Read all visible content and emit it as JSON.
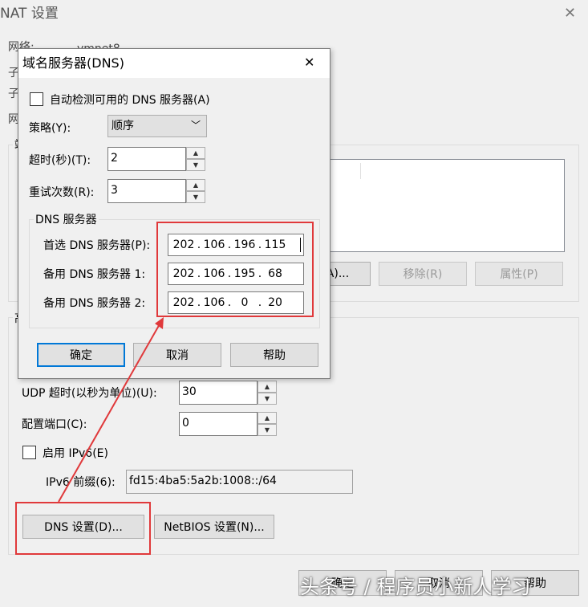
{
  "nat_window": {
    "title": "NAT 设置",
    "network_label": "网络:",
    "network_value": "vmnet8",
    "subnet_ip_label": "子",
    "subnet_mask_label": "子",
    "gateway_label": "网",
    "port_forward_label": "端",
    "buttons": {
      "add": "A)...",
      "remove": "移除(R)",
      "properties": "属性(P)"
    },
    "advanced_label": "高",
    "udp_timeout_label": "UDP 超时(以秒为单位)(U):",
    "udp_timeout_value": "30",
    "config_port_label": "配置端口(C):",
    "config_port_value": "0",
    "enable_ipv6_label": "启用 IPv6(E)",
    "ipv6_prefix_label": "IPv6 前缀(6):",
    "ipv6_prefix_value": "fd15:4ba5:5a2b:1008::/64",
    "dns_settings_button": "DNS 设置(D)...",
    "netbios_settings_button": "NetBIOS 设置(N)...",
    "ok_button": "确定",
    "cancel_button": "取消",
    "help_button": "帮助"
  },
  "dns_dialog": {
    "title": "域名服务器(DNS)",
    "auto_detect_label": "自动检测可用的 DNS 服务器(A)",
    "policy_label": "策略(Y):",
    "policy_value": "顺序",
    "timeout_label": "超时(秒)(T):",
    "timeout_value": "2",
    "retries_label": "重试次数(R):",
    "retries_value": "3",
    "dns_group_label": "DNS 服务器",
    "preferred_label": "首选 DNS 服务器(P):",
    "preferred_ip": [
      "202",
      "106",
      "196",
      "115"
    ],
    "alternate1_label": "备用 DNS 服务器 1:",
    "alternate1_ip": [
      "202",
      "106",
      "195",
      "68"
    ],
    "alternate2_label": "备用 DNS 服务器 2:",
    "alternate2_ip": [
      "202",
      "106",
      "0",
      "20"
    ],
    "ok_button": "确定",
    "cancel_button": "取消",
    "help_button": "帮助"
  },
  "watermark": "头条号 / 程序员小新人学习",
  "icons": {
    "close": "close-icon",
    "dropdown": "chevron-down-icon",
    "spin_up": "spin-up-icon",
    "spin_down": "spin-down-icon"
  },
  "colors": {
    "highlight_red": "#e0393b",
    "focus_blue": "#0078d7"
  }
}
